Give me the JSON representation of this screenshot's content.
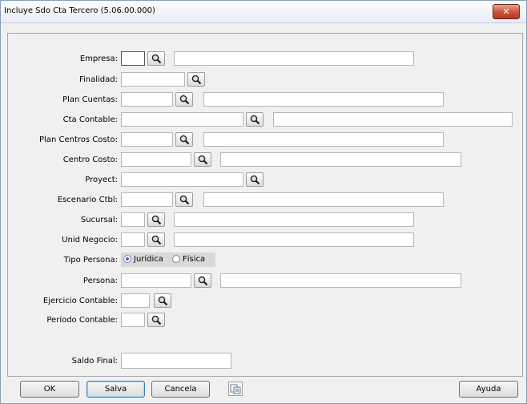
{
  "window": {
    "title": "Incluye Sdo Cta Tercero (5.06.00.000)",
    "close_symbol": "✕"
  },
  "fields": {
    "empresa": "Empresa:",
    "finalidad": "Finalidad:",
    "plan_cuentas": "Plan Cuentas:",
    "cta_contable": "Cta Contable:",
    "plan_centros_costo": "Plan Centros Costo:",
    "centro_costo": "Centro Costo:",
    "proyect": "Proyect:",
    "escenario_ctbl": "Escenario Ctbl:",
    "sucursal": "Sucursal:",
    "unid_negocio": "Unid Negocio:",
    "tipo_persona": "Tipo Persona:",
    "persona": "Persona:",
    "ejercicio_contable": "Ejercicio Contable:",
    "periodo_contable": "Período Contable:",
    "saldo_final": "Saldo Final:"
  },
  "tipo_persona_options": {
    "juridica": "Jurídica",
    "fisica": "Física",
    "selected": "Jurídica"
  },
  "buttons": {
    "ok": "OK",
    "salva": "Salva",
    "cancela": "Cancela",
    "ayuda": "Ayuda"
  },
  "icons": {
    "search": "search-icon",
    "close": "close-icon",
    "attach": "attach-icon"
  }
}
